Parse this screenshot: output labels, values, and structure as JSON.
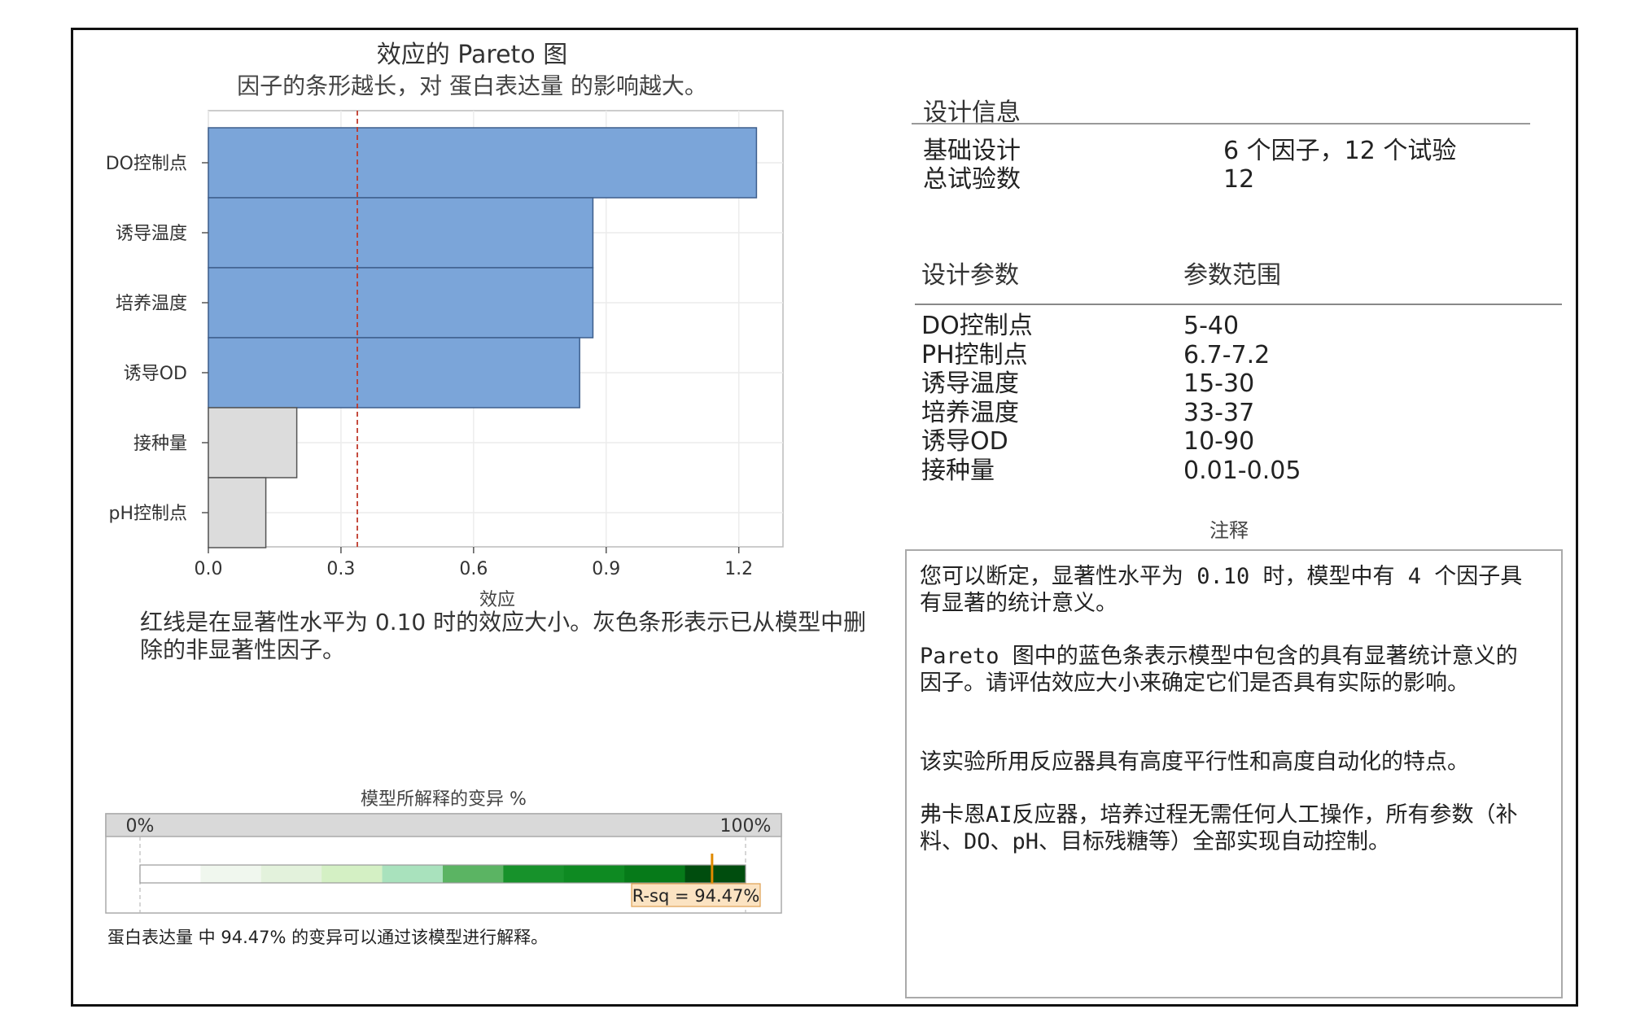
{
  "pareto": {
    "title": "效应的 Pareto 图",
    "subtitle": "因子的条形越长，对 蛋白表达量 的影响越大。",
    "note": "红线是在显著性水平为 0.10 时的效应大小。灰色条形表示已从模型中删除的非显著性因子。"
  },
  "chart_data": [
    {
      "type": "bar",
      "orientation": "horizontal",
      "categories": [
        "DO控制点",
        "诱导温度",
        "培养温度",
        "诱导OD",
        "接种量",
        "pH控制点"
      ],
      "values": [
        1.24,
        0.87,
        0.87,
        0.84,
        0.2,
        0.13
      ],
      "significant": [
        true,
        true,
        true,
        true,
        false,
        false
      ],
      "colors": {
        "significant": "#7ba5d9",
        "non_significant": "#dcdcdc",
        "reference_line": "#c0392b"
      },
      "reference_line": 0.337,
      "xlabel": "效应",
      "xlim": [
        0,
        1.3
      ],
      "xticks": [
        "0.0",
        "0.3",
        "0.6",
        "0.9",
        "1.2"
      ],
      "grid": true
    },
    {
      "type": "bar",
      "title": "模型所解释的变异 %",
      "scale_labels": [
        "0%",
        "100%"
      ],
      "value": 94.47,
      "value_label": "R-sq = 94.47%",
      "gradient_colors": [
        "#ffffff",
        "#f0f7ee",
        "#e3f2dc",
        "#d4f0c4",
        "#a9e2bd",
        "#5bb463",
        "#17922b",
        "#0e8a22",
        "#067a19",
        "#004d0e"
      ],
      "marker_color": "#e08a00"
    }
  ],
  "variance": {
    "footnote": "蛋白表达量 中 94.47% 的变异可以通过该模型进行解释。"
  },
  "design_info": {
    "heading": "设计信息",
    "rows": [
      {
        "label": "基础设计",
        "value": "6 个因子，12 个试验"
      },
      {
        "label": "总试验数",
        "value": "12"
      }
    ]
  },
  "design_params": {
    "col1": "设计参数",
    "col2": "参数范围",
    "rows": [
      {
        "name": "DO控制点",
        "range": "5-40"
      },
      {
        "name": "PH控制点",
        "range": "6.7-7.2"
      },
      {
        "name": "诱导温度",
        "range": "15-30"
      },
      {
        "name": "培养温度",
        "range": "33-37"
      },
      {
        "name": "诱导OD",
        "range": "10-90"
      },
      {
        "name": "接种量",
        "range": "0.01-0.05"
      }
    ]
  },
  "notes": {
    "label": "注释",
    "p1": "您可以断定，显著性水平为 0.10 时，模型中有 4 个因子具有显著的统计意义。",
    "p2": "Pareto 图中的蓝色条表示模型中包含的具有显著统计意义的因子。请评估效应大小来确定它们是否具有实际的影响。",
    "p3": "该实验所用反应器具有高度平行性和高度自动化的特点。",
    "p4": "弗卡恩AI反应器，培养过程无需任何人工操作，所有参数（补料、DO、pH、目标残糖等）全部实现自动控制。"
  }
}
